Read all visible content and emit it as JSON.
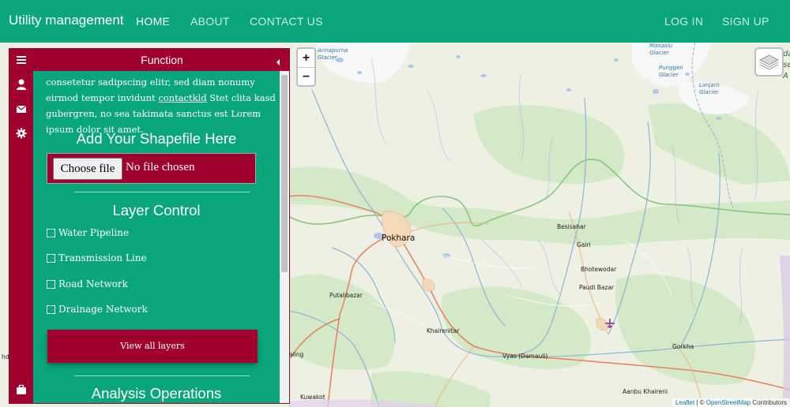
{
  "navbar": {
    "brand": "Utility management",
    "links": {
      "home": "HOME",
      "about": "ABOUT",
      "contact": "CONTACT US",
      "login": "LOG IN",
      "signup": "SIGN UP"
    }
  },
  "sidebar": {
    "tabs": [
      "menu-icon",
      "user-icon",
      "envelope-icon",
      "gear-icon",
      "briefcase-icon"
    ],
    "pane_title": "Function",
    "intro": {
      "before_link": "consetetur sadipscing elitr, sed diam nonumy eirmod tempor invidunt ",
      "link": "contactkld",
      "after_link": " Stet clita kasd gubergren, no sea takimata sanctus est Lorem ipsum dolor sit amet."
    },
    "shapefile": {
      "heading": "Add Your Shapefile Here",
      "button_label": "Choose file",
      "status": "No file chosen"
    },
    "layer_control": {
      "heading": "Layer Control",
      "layers": [
        "Water Pipeline",
        "Transmission Line",
        "Road Network",
        "Drainage Network"
      ],
      "checked": [
        false,
        false,
        false,
        false
      ]
    },
    "view_all_label": "View all layers",
    "analysis_heading": "Analysis Operations"
  },
  "map": {
    "zoom_in": "+",
    "zoom_out": "−",
    "places": {
      "pokhara": "Pokhara",
      "besisahar": "Besisahar",
      "gairi": "Gairi",
      "bhotewodar": "Bhotewodar",
      "paudi_bazar": "Paudi Bazar",
      "putalibazar": "Putalibazar",
      "khairenitar": "Khairenitar",
      "vyas": "Vyas (Damauli)",
      "gorkha": "Gorkha",
      "aanbu_khaireni": "Aanbu Khaireni",
      "kuwakot": "Kuwakot",
      "aling": "aling",
      "hdi": "hdi"
    },
    "glaciers": {
      "annapurna": "Annapurna\nGlacier",
      "manaslu": "Manaslu\nGlacier",
      "punggen": "Punggen\nGlacier",
      "lanjam": "Lanjam\nGlacier"
    },
    "edge_labels": [
      "da",
      "se",
      "A"
    ],
    "attribution": {
      "leaflet": "Leaflet",
      "separator": " | © ",
      "osm": "OpenStreetMap",
      "suffix": " Contributors"
    }
  },
  "colors": {
    "brand_green": "#0aa67b",
    "accent_red": "#a0002d",
    "road_orange": "#e8805a",
    "river_blue": "#8ab5d9"
  }
}
